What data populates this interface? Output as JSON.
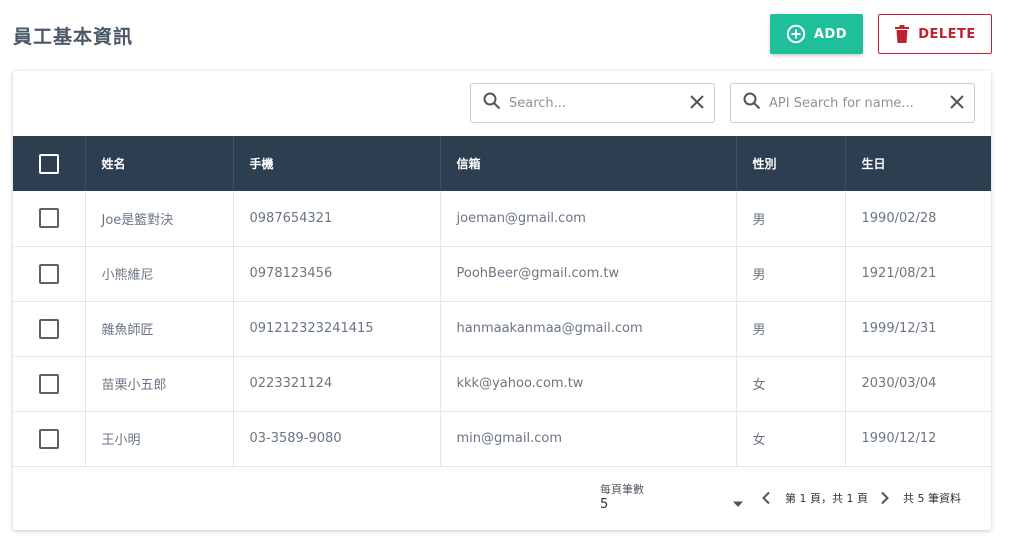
{
  "header": {
    "title": "員工基本資訊"
  },
  "toolbar": {
    "add_label": "ADD",
    "delete_label": "DELETE"
  },
  "search": {
    "placeholder": "Search...",
    "api_placeholder": "API Search for name..."
  },
  "table": {
    "columns": [
      "姓名",
      "手機",
      "信箱",
      "性別",
      "生日"
    ],
    "rows": [
      {
        "name": "Joe是籃對決",
        "phone": "0987654321",
        "email": "joeman@gmail.com",
        "gender": "男",
        "birthday": "1990/02/28"
      },
      {
        "name": "小熊維尼",
        "phone": "0978123456",
        "email": "PoohBeer@gmail.com.tw",
        "gender": "男",
        "birthday": "1921/08/21"
      },
      {
        "name": "雜魚師匠",
        "phone": "091212323241415",
        "email": "hanmaakanmaa@gmail.com",
        "gender": "男",
        "birthday": "1999/12/31"
      },
      {
        "name": "苗栗小五郎",
        "phone": "0223321124",
        "email": "kkk@yahoo.com.tw",
        "gender": "女",
        "birthday": "2030/03/04"
      },
      {
        "name": "王小明",
        "phone": "03-3589-9080",
        "email": "min@gmail.com",
        "gender": "女",
        "birthday": "1990/12/12"
      }
    ]
  },
  "pagination": {
    "rows_per_page_label": "每頁筆數",
    "rows_per_page_value": "5",
    "page_info": "第 1 頁，共 1 頁",
    "total_info": "共 5 筆資料"
  },
  "colors": {
    "header_bg": "#2d3e50",
    "add_button": "#1fbf9c",
    "delete_button": "#c0202f"
  }
}
